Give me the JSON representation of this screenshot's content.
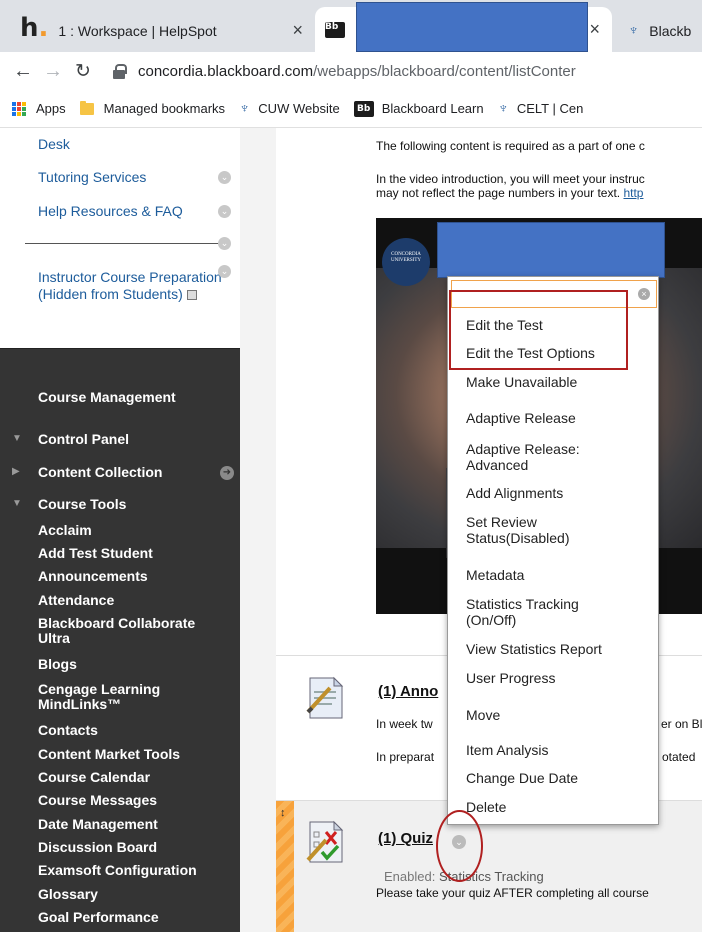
{
  "browser": {
    "tabs": [
      {
        "title": "1 : Workspace | HelpSpot",
        "close": "×"
      },
      {
        "title": "",
        "close": "×"
      },
      {
        "title": "Blackb"
      }
    ],
    "address": {
      "host": "concordia.blackboard.com",
      "path": "/webapps/blackboard/content/listConter"
    },
    "bookmarks": [
      "Apps",
      "Managed bookmarks",
      "CUW Website",
      "Blackboard Learn",
      "CELT | Cen"
    ],
    "icons": {
      "tab1_logo": "h.",
      "bb_logo": "Bb"
    }
  },
  "course_menu": {
    "items": [
      "Desk",
      "Tutoring Services",
      "Help Resources & FAQ",
      "Instructor Course Preparation (Hidden from Students)"
    ]
  },
  "control_panel": {
    "course_management": "Course Management",
    "control_panel": "Control Panel",
    "content_collection": "Content Collection",
    "course_tools": "Course Tools",
    "tools": [
      "Acclaim",
      "Add Test Student",
      "Announcements",
      "Attendance",
      "Blackboard Collaborate Ultra",
      "Blogs",
      "Cengage Learning MindLinks™",
      "Contacts",
      "Content Market Tools",
      "Course Calendar",
      "Course Messages",
      "Date Management",
      "Discussion Board",
      "Examsoft Configuration",
      "Glossary",
      "Goal Performance"
    ]
  },
  "content": {
    "intro_line1": "The following content is required as a part of one c",
    "intro_line2": "In the video introduction, you will meet your instruc",
    "intro_line3": "may not reflect the page numbers in your text.",
    "intro_link": "http",
    "video_logo": "CONCORDIA UNIVERSITY",
    "item1_title": "(1) Anno",
    "item1_line1_a": "In week tw",
    "item1_line1_b": "er on Bl",
    "item1_line2_a": "In preparat",
    "item1_line2_b": "otated",
    "quiz_title": "(1) Quiz",
    "quiz_enabled_label": "Enabled:",
    "quiz_enabled_value": "Statistics Tracking",
    "quiz_note": "Please take your quiz AFTER completing all course"
  },
  "context_menu": {
    "items": [
      "Edit the Test",
      "Edit the Test Options",
      "Make Unavailable",
      "Adaptive Release",
      "Adaptive Release: Advanced",
      "Add Alignments",
      "Set Review Status(Disabled)",
      "Metadata",
      "Statistics Tracking (On/Off)",
      "View Statistics Report",
      "User Progress",
      "Move",
      "Item Analysis",
      "Change Due Date",
      "Delete"
    ]
  },
  "colors": {
    "link": "#1d5c9b",
    "dark_panel": "#343434",
    "highlight": "#b02020",
    "redaction": "#4472c4"
  }
}
